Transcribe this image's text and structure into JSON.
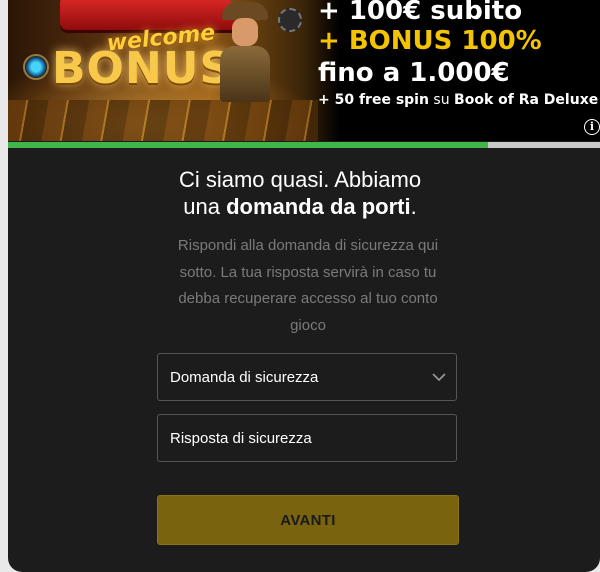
{
  "banner": {
    "welcome_text": "welcome",
    "bonus_text": "BONUS",
    "promo_line1": "+ 100€ subito",
    "promo_line2": "+ BONUS 100%",
    "promo_line3": "fino a 1.000€",
    "promo_line4_bold": "+ 50 free spin",
    "promo_line4_thin": " su ",
    "promo_line4_game": "Book of Ra Deluxe",
    "info_icon": "i",
    "accent_color": "#f5c400"
  },
  "progress": {
    "value_percent": 81,
    "color": "#3fb54a"
  },
  "heading": {
    "line1": "Ci siamo quasi. Abbiamo",
    "line2_prefix": "una ",
    "line2_bold": "domanda da porti",
    "line2_suffix": "."
  },
  "description": "Rispondi alla domanda di sicurezza qui sotto. La tua risposta servirà in caso tu debba recuperare accesso al tuo conto gioco",
  "form": {
    "question_select_value": "Domanda di sicurezza",
    "answer_placeholder": "Risposta di sicurezza",
    "submit_label": "AVANTI",
    "submit_color": "#7a630f"
  }
}
